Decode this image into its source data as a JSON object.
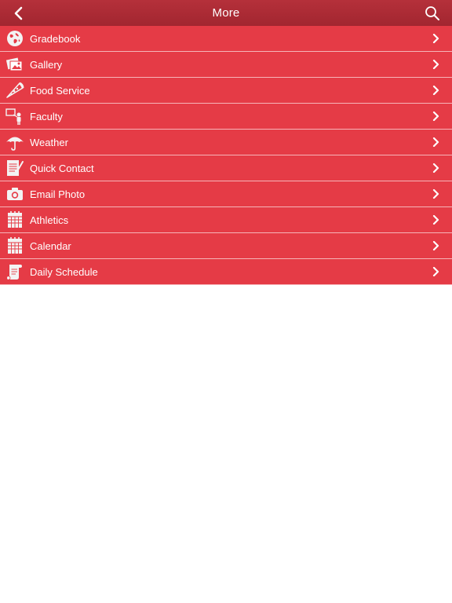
{
  "header": {
    "title": "More",
    "back_icon": "chevron-left-icon",
    "search_icon": "search-icon"
  },
  "menu": {
    "items": [
      {
        "label": "Gradebook",
        "icon": "globe-icon"
      },
      {
        "label": "Gallery",
        "icon": "photos-icon"
      },
      {
        "label": "Food Service",
        "icon": "pizza-icon"
      },
      {
        "label": "Faculty",
        "icon": "teacher-icon"
      },
      {
        "label": "Weather",
        "icon": "umbrella-icon"
      },
      {
        "label": "Quick Contact",
        "icon": "notepad-icon"
      },
      {
        "label": "Email Photo",
        "icon": "camera-icon"
      },
      {
        "label": "Athletics",
        "icon": "calendar-icon"
      },
      {
        "label": "Calendar",
        "icon": "calendar-icon"
      },
      {
        "label": "Daily Schedule",
        "icon": "scroll-icon"
      }
    ]
  },
  "colors": {
    "header": "#a92a33",
    "row": "#e53b46",
    "divider": "#f6b4b8",
    "text": "#ffffff",
    "background": "#ffffff"
  }
}
